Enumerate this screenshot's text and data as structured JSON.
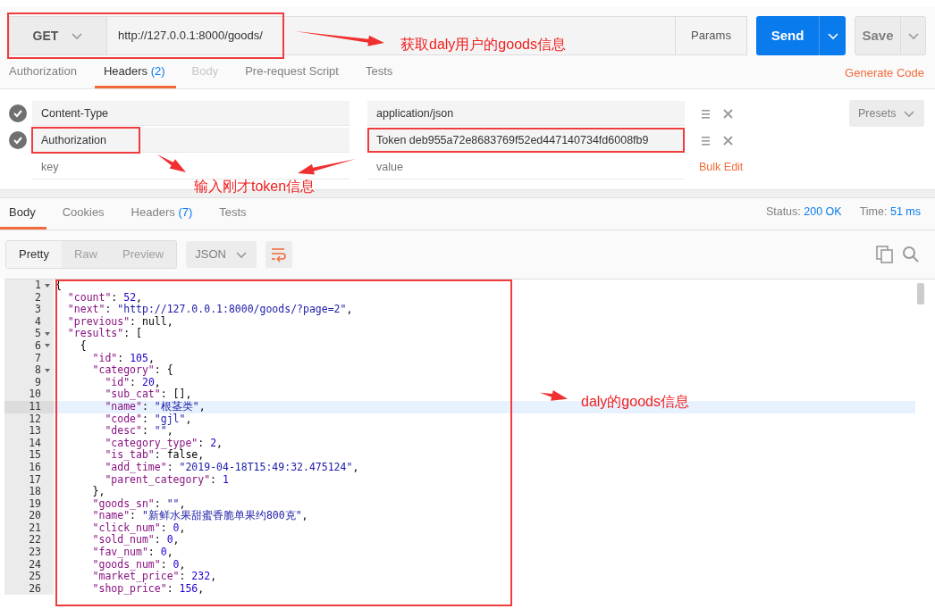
{
  "request": {
    "method": "GET",
    "url": "http://127.0.0.1:8000/goods/",
    "params_label": "Params",
    "send_label": "Send",
    "save_label": "Save"
  },
  "request_tabs": [
    {
      "label": "Authorization",
      "selected": false,
      "disabled": false
    },
    {
      "label": "Headers",
      "count": "(2)",
      "selected": true,
      "disabled": false
    },
    {
      "label": "Body",
      "selected": false,
      "disabled": true
    },
    {
      "label": "Pre-request Script",
      "selected": false,
      "disabled": false
    },
    {
      "label": "Tests",
      "selected": false,
      "disabled": false
    }
  ],
  "generate_code": "Generate Code",
  "headers": [
    {
      "key": "Content-Type",
      "value": "application/json",
      "checked": true
    },
    {
      "key": "Authorization",
      "value": "Token deb955a72e8683769f52ed447140734fd6008fb9",
      "checked": true
    }
  ],
  "new_header": {
    "key_placeholder": "key",
    "value_placeholder": "value"
  },
  "bulk_edit": "Bulk Edit",
  "presets": "Presets",
  "response_tabs": [
    {
      "label": "Body",
      "selected": true
    },
    {
      "label": "Cookies",
      "selected": false
    },
    {
      "label": "Headers",
      "count": "(7)",
      "selected": false
    },
    {
      "label": "Tests",
      "selected": false
    }
  ],
  "status": {
    "label": "Status:",
    "value": "200 OK"
  },
  "time": {
    "label": "Time:",
    "value": "51 ms"
  },
  "view_modes": [
    {
      "label": "Pretty",
      "selected": true
    },
    {
      "label": "Raw",
      "selected": false
    },
    {
      "label": "Preview",
      "selected": false
    }
  ],
  "format": "JSON",
  "code_lines": [
    {
      "number": "1",
      "fold": true,
      "selected": false,
      "code": "{"
    },
    {
      "number": "2",
      "fold": false,
      "selected": false,
      "code": "  \"count\": 52,"
    },
    {
      "number": "3",
      "fold": false,
      "selected": false,
      "code": "  \"next\": \"http://127.0.0.1:8000/goods/?page=2\","
    },
    {
      "number": "4",
      "fold": false,
      "selected": false,
      "code": "  \"previous\": null,"
    },
    {
      "number": "5",
      "fold": true,
      "selected": false,
      "code": "  \"results\": ["
    },
    {
      "number": "6",
      "fold": true,
      "selected": false,
      "code": "    {"
    },
    {
      "number": "7",
      "fold": false,
      "selected": false,
      "code": "      \"id\": 105,"
    },
    {
      "number": "8",
      "fold": true,
      "selected": false,
      "code": "      \"category\": {"
    },
    {
      "number": "9",
      "fold": false,
      "selected": false,
      "code": "        \"id\": 20,"
    },
    {
      "number": "10",
      "fold": false,
      "selected": false,
      "code": "        \"sub_cat\": [],"
    },
    {
      "number": "11",
      "fold": false,
      "selected": true,
      "code": "        \"name\": \"根茎类\","
    },
    {
      "number": "12",
      "fold": false,
      "selected": false,
      "code": "        \"code\": \"gjl\","
    },
    {
      "number": "13",
      "fold": false,
      "selected": false,
      "code": "        \"desc\": \"\","
    },
    {
      "number": "14",
      "fold": false,
      "selected": false,
      "code": "        \"category_type\": 2,"
    },
    {
      "number": "15",
      "fold": false,
      "selected": false,
      "code": "        \"is_tab\": false,"
    },
    {
      "number": "16",
      "fold": false,
      "selected": false,
      "code": "        \"add_time\": \"2019-04-18T15:49:32.475124\","
    },
    {
      "number": "17",
      "fold": false,
      "selected": false,
      "code": "        \"parent_category\": 1"
    },
    {
      "number": "18",
      "fold": false,
      "selected": false,
      "code": "      },"
    },
    {
      "number": "19",
      "fold": false,
      "selected": false,
      "code": "      \"goods_sn\": \"\","
    },
    {
      "number": "20",
      "fold": false,
      "selected": false,
      "code": "      \"name\": \"新鲜水果甜蜜香脆单果约800克\","
    },
    {
      "number": "21",
      "fold": false,
      "selected": false,
      "code": "      \"click_num\": 0,"
    },
    {
      "number": "22",
      "fold": false,
      "selected": false,
      "code": "      \"sold_num\": 0,"
    },
    {
      "number": "23",
      "fold": false,
      "selected": false,
      "code": "      \"fav_num\": 0,"
    },
    {
      "number": "24",
      "fold": false,
      "selected": false,
      "code": "      \"goods_num\": 0,"
    },
    {
      "number": "25",
      "fold": false,
      "selected": false,
      "code": "      \"market_price\": 232,"
    },
    {
      "number": "26",
      "fold": false,
      "selected": false,
      "code": "      \"shop_price\": 156,"
    }
  ],
  "annotations": [
    "获取daly用户的goods信息",
    "输入刚才token信息",
    "daly的goods信息"
  ]
}
